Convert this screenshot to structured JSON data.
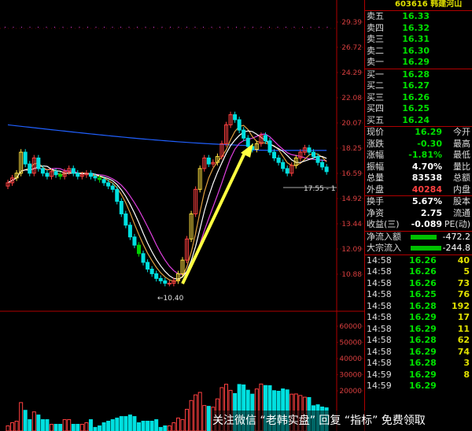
{
  "stock": {
    "code": "603616",
    "name": "韩建河山"
  },
  "price_axis": [
    "29.39",
    "26.72",
    "24.29",
    "22.08",
    "20.07",
    "18.25",
    "16.59",
    "14.92",
    "13.44",
    "12.09",
    "10.88"
  ],
  "volume_axis": [
    "60000",
    "50000",
    "40000",
    "30000",
    "20000"
  ],
  "annotations": {
    "low_label": "←10.40",
    "right_label": "17.55 - 1"
  },
  "colors": {
    "up": "#ff4040",
    "down": "#00e0e0",
    "ma1": "#2060ff",
    "ma2": "#e040e0",
    "ma3": "#e0a040",
    "arrow": "#ffff40",
    "bid_ask": "#00e000"
  },
  "ask": [
    {
      "label": "卖五",
      "price": "16.33",
      "vol": ""
    },
    {
      "label": "卖四",
      "price": "16.32",
      "vol": ""
    },
    {
      "label": "卖三",
      "price": "16.31",
      "vol": ""
    },
    {
      "label": "卖二",
      "price": "16.30",
      "vol": ""
    },
    {
      "label": "卖一",
      "price": "16.29",
      "vol": ""
    }
  ],
  "bid": [
    {
      "label": "买一",
      "price": "16.28",
      "vol": ""
    },
    {
      "label": "买二",
      "price": "16.27",
      "vol": ""
    },
    {
      "label": "买三",
      "price": "16.26",
      "vol": ""
    },
    {
      "label": "买四",
      "price": "16.25",
      "vol": ""
    },
    {
      "label": "买五",
      "price": "16.24",
      "vol": ""
    }
  ],
  "quote": [
    {
      "label": "现价",
      "value": "16.29",
      "label2": "今开",
      "color": "green"
    },
    {
      "label": "涨跌",
      "value": "-0.30",
      "label2": "最高",
      "color": "green"
    },
    {
      "label": "涨幅",
      "value": "-1.81%",
      "label2": "最低",
      "color": "green"
    },
    {
      "label": "振幅",
      "value": "4.70%",
      "label2": "量比",
      "color": "white"
    },
    {
      "label": "总量",
      "value": "83538",
      "label2": "总额",
      "color": "white"
    },
    {
      "label": "外盘",
      "value": "40284",
      "label2": "内盘",
      "color": "red"
    }
  ],
  "stats": [
    {
      "label": "换手",
      "value": "5.67%",
      "label2": "股本"
    },
    {
      "label": "净资",
      "value": "2.75",
      "label2": "流通"
    },
    {
      "label": "收益(三)",
      "value": "-0.089",
      "label2": "PE(动)"
    }
  ],
  "flows": [
    {
      "label": "净流入额",
      "value": "-472.2",
      "level": 0.6
    },
    {
      "label": "大宗流入",
      "value": "-244.8",
      "level": 0.7
    }
  ],
  "ticks": [
    {
      "time": "14:58",
      "price": "16.26",
      "vol": "40"
    },
    {
      "time": "14:58",
      "price": "16.26",
      "vol": "5"
    },
    {
      "time": "14:58",
      "price": "16.26",
      "vol": "73"
    },
    {
      "time": "14:58",
      "price": "16.25",
      "vol": "76"
    },
    {
      "time": "14:58",
      "price": "16.28",
      "vol": "192"
    },
    {
      "time": "14:58",
      "price": "16.29",
      "vol": "17"
    },
    {
      "time": "14:58",
      "price": "16.29",
      "vol": "11"
    },
    {
      "time": "14:58",
      "price": "16.28",
      "vol": "62"
    },
    {
      "time": "14:58",
      "price": "16.29",
      "vol": "74"
    },
    {
      "time": "14:58",
      "price": "16.28",
      "vol": "3"
    },
    {
      "time": "14:59",
      "price": "16.29",
      "vol": "8"
    },
    {
      "time": "14:59",
      "price": "16.29",
      "vol": ""
    }
  ],
  "watermark": "关注微信 “老韩实盘” 回复 “指标” 免费领取"
}
